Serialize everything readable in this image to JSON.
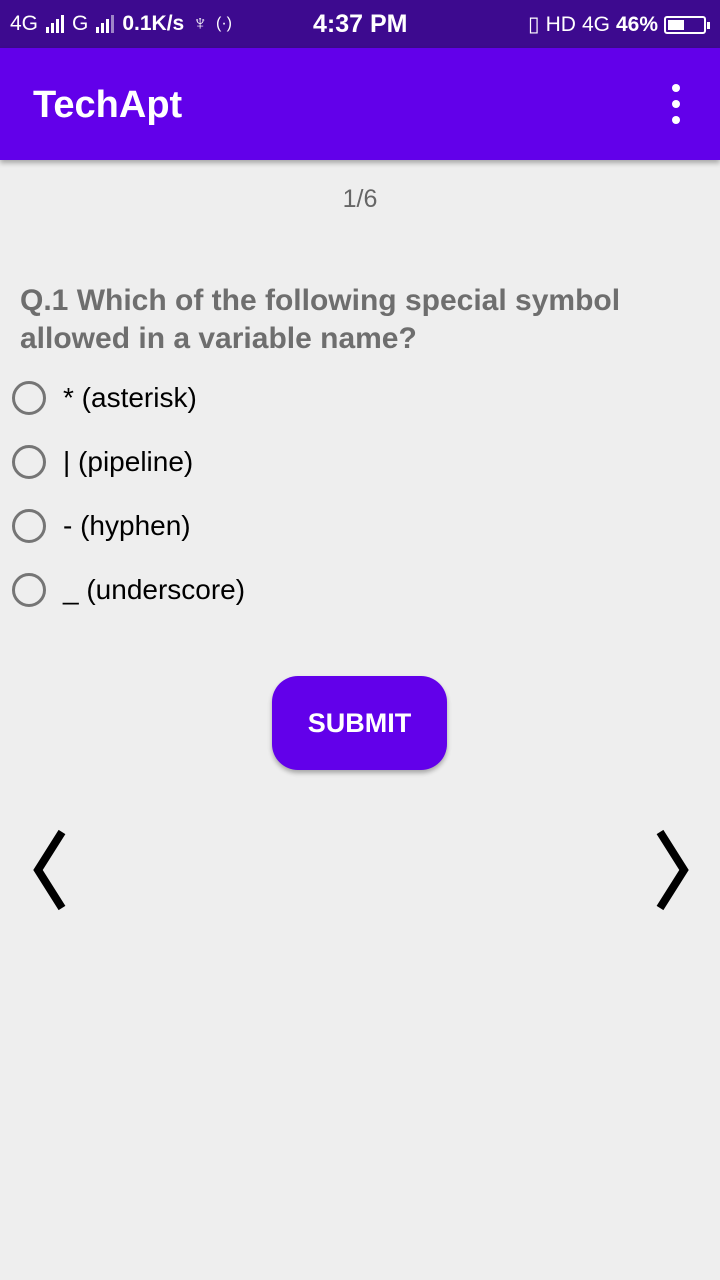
{
  "status_bar": {
    "network_left": "4G",
    "network_right": "G",
    "speed": "0.1K/s",
    "usb": "♆",
    "hotspot": "(·)",
    "time": "4:37 PM",
    "vibrate": "▯",
    "hd": "HD",
    "network_4g": "4G",
    "battery": "46%"
  },
  "app_bar": {
    "title": "TechApt"
  },
  "quiz": {
    "counter": "1/6",
    "question": "Q.1 Which of the following special symbol allowed in a variable name?",
    "options": [
      {
        "label": "* (asterisk)"
      },
      {
        "label": "| (pipeline)"
      },
      {
        "label": "- (hyphen)"
      },
      {
        "label": "_ (underscore)"
      }
    ],
    "submit_label": "SUBMIT"
  },
  "colors": {
    "status_bar": "#3d0a8f",
    "primary": "#6200ea",
    "background": "#eeeeee",
    "question_text": "#6e6e6e",
    "radio_border": "#757575"
  },
  "icons": {
    "prev": "chevron-left-icon",
    "next": "chevron-right-icon",
    "overflow": "more-vert-icon"
  }
}
